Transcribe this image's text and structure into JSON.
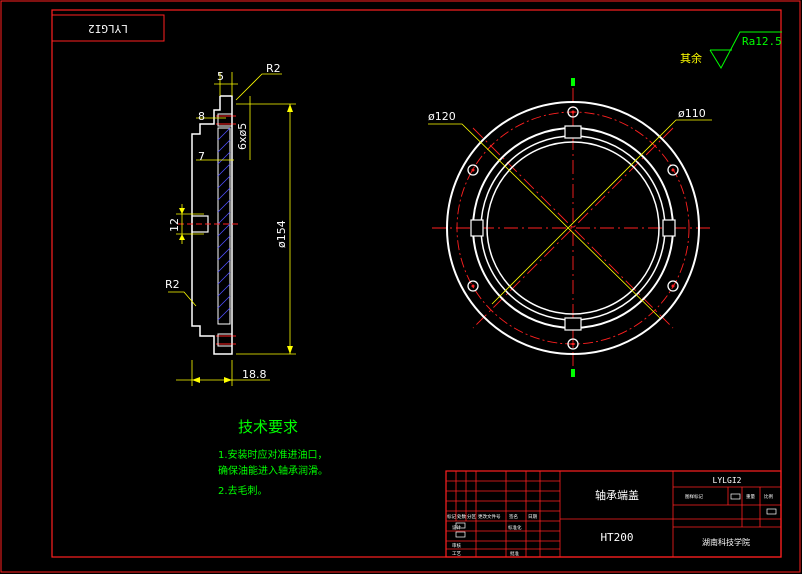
{
  "drawing_code_stamp": "LYLGI2",
  "surface_finish": {
    "label": "其余",
    "value": "Ra12.5"
  },
  "side_view": {
    "dims": {
      "top_width": "5",
      "fillet_top": "R2",
      "step_width": "8",
      "hole_spec": "6xø5",
      "step_depth": "7",
      "slot_height": "12",
      "diameter": "ø154",
      "fillet_bottom": "R2",
      "overall_width": "18.8"
    }
  },
  "front_view": {
    "dims": {
      "outer_diameter": "ø120",
      "inner_diameter": "ø110"
    }
  },
  "tech_requirements": {
    "title": "技术要求",
    "lines": [
      "1.安装时应对准进油口，",
      "确保油能进入轴承润滑。",
      "2.去毛刺。"
    ]
  },
  "title_block": {
    "part_name": "轴承端盖",
    "material": "HT200",
    "drawing_code": "LYLGI2",
    "school": "湖南科技学院",
    "small_labels": {
      "marks": "标记",
      "count": "处数",
      "division": "分区",
      "change_doc": "更改文件号",
      "signature": "签名",
      "date": "日期",
      "design": "设计",
      "standardize": "标准化",
      "review": "审核",
      "process": "工艺",
      "approve": "批准",
      "stage_mark": "图样标记",
      "weight": "重量",
      "scale": "比例"
    }
  }
}
